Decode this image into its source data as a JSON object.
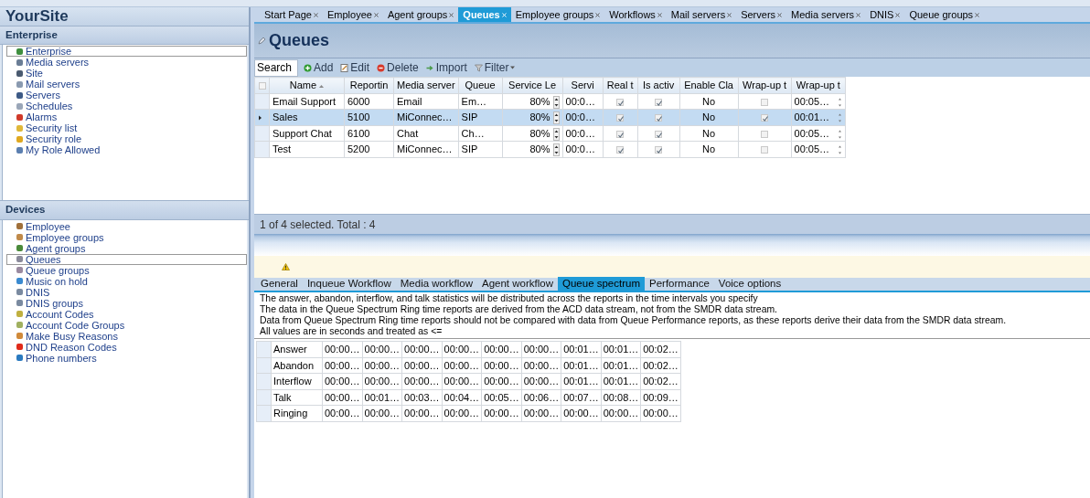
{
  "sidebar": {
    "title": "YourSite",
    "sections": [
      {
        "title": "Enterprise",
        "items": [
          {
            "label": "Enterprise",
            "selected": true,
            "color": "#3f8f3f"
          },
          {
            "label": "Media servers",
            "selected": false,
            "color": "#6a7d95"
          },
          {
            "label": "Site",
            "selected": false,
            "color": "#4a5a70"
          },
          {
            "label": "Mail servers",
            "selected": false,
            "color": "#8a9ab0"
          },
          {
            "label": "Servers",
            "selected": false,
            "color": "#3d5a86"
          },
          {
            "label": "Schedules",
            "selected": false,
            "color": "#9aa6b8"
          },
          {
            "label": "Alarms",
            "selected": false,
            "color": "#d03a2a"
          },
          {
            "label": "Security list",
            "selected": false,
            "color": "#e0b83a"
          },
          {
            "label": "Security role",
            "selected": false,
            "color": "#e0a820"
          },
          {
            "label": "My Role Allowed",
            "selected": false,
            "color": "#5b7fb0"
          }
        ]
      },
      {
        "title": "Devices",
        "items": [
          {
            "label": "Employee",
            "selected": false,
            "color": "#a0703a"
          },
          {
            "label": "Employee groups",
            "selected": false,
            "color": "#c08a4a"
          },
          {
            "label": "Agent groups",
            "selected": false,
            "color": "#4a8a3a"
          },
          {
            "label": "Queues",
            "selected": true,
            "color": "#8a8a9a"
          },
          {
            "label": "Queue groups",
            "selected": false,
            "color": "#9a8aa0"
          },
          {
            "label": "Music on hold",
            "selected": false,
            "color": "#3a8ad0"
          },
          {
            "label": "DNIS",
            "selected": false,
            "color": "#7a8aa0"
          },
          {
            "label": "DNIS groups",
            "selected": false,
            "color": "#7a8aa0"
          },
          {
            "label": "Account Codes",
            "selected": false,
            "color": "#c0b040"
          },
          {
            "label": "Account Code Groups",
            "selected": false,
            "color": "#a0b060"
          },
          {
            "label": "Make Busy Reasons",
            "selected": false,
            "color": "#d08a3a"
          },
          {
            "label": "DND Reason Codes",
            "selected": false,
            "color": "#e02a1a"
          },
          {
            "label": "Phone numbers",
            "selected": false,
            "color": "#2a7ac0"
          }
        ]
      }
    ]
  },
  "tabs": [
    {
      "label": "Start Page",
      "selected": false
    },
    {
      "label": "Employee",
      "selected": false
    },
    {
      "label": "Agent groups",
      "selected": false
    },
    {
      "label": "Queues",
      "selected": true
    },
    {
      "label": "Employee groups",
      "selected": false
    },
    {
      "label": "Workflows",
      "selected": false
    },
    {
      "label": "Mail servers",
      "selected": false
    },
    {
      "label": "Servers",
      "selected": false
    },
    {
      "label": "Media servers",
      "selected": false
    },
    {
      "label": "DNIS",
      "selected": false
    },
    {
      "label": "Queue groups",
      "selected": false
    }
  ],
  "page_title": "Queues",
  "toolbar": {
    "search": {
      "value": "Search"
    },
    "buttons": [
      {
        "kind": "add",
        "label": "Add"
      },
      {
        "kind": "edit",
        "label": "Edit"
      },
      {
        "kind": "delete",
        "label": "Delete"
      },
      {
        "kind": "import",
        "label": "Import"
      },
      {
        "kind": "filter",
        "label": "Filter"
      }
    ]
  },
  "grid": {
    "columns": [
      {
        "label": "Name",
        "kind": "text"
      },
      {
        "label": "Reportin",
        "kind": "text"
      },
      {
        "label": "Media server",
        "kind": "text"
      },
      {
        "label": "Queue",
        "kind": "text"
      },
      {
        "label": "Service Le",
        "kind": "spin"
      },
      {
        "label": "Servi",
        "kind": "text"
      },
      {
        "label": "Real t",
        "kind": "checkbox"
      },
      {
        "label": "Is activ",
        "kind": "checkbox"
      },
      {
        "label": "Enable Cla",
        "kind": "center"
      },
      {
        "label": "Wrap-up t",
        "kind": "checkbox"
      },
      {
        "label": "Wrap-up t",
        "kind": "time"
      }
    ],
    "rows": [
      {
        "selected": false,
        "cells": [
          "Email Support",
          "6000",
          "Email",
          "Em…",
          "80%",
          "00:0…",
          {
            "checked": true
          },
          {
            "checked": true
          },
          "No",
          {
            "checked": false
          },
          "00:05…"
        ]
      },
      {
        "selected": true,
        "cells": [
          "Sales",
          "5100",
          "MiConnec…",
          "SIP",
          "80%",
          "00:0…",
          {
            "checked": true
          },
          {
            "checked": true
          },
          "No",
          {
            "checked": true
          },
          "00:01…"
        ]
      },
      {
        "selected": false,
        "cells": [
          "Support Chat",
          "6100",
          "Chat",
          "Ch…",
          "80%",
          "00:0…",
          {
            "checked": true
          },
          {
            "checked": true
          },
          "No",
          {
            "checked": false
          },
          "00:05…"
        ]
      },
      {
        "selected": false,
        "cells": [
          "Test",
          "5200",
          "MiConnec…",
          "SIP",
          "80%",
          "00:0…",
          {
            "checked": true
          },
          {
            "checked": true
          },
          "No",
          {
            "checked": false
          },
          "00:05…"
        ]
      }
    ]
  },
  "status": "1 of 4 selected. Total : 4",
  "detail_tabs": [
    {
      "label": "General",
      "selected": false
    },
    {
      "label": "Inqueue Workflow",
      "selected": false
    },
    {
      "label": "Media workflow",
      "selected": false
    },
    {
      "label": "Agent workflow",
      "selected": false
    },
    {
      "label": "Queue spectrum",
      "selected": true
    },
    {
      "label": "Performance",
      "selected": false
    },
    {
      "label": "Voice options",
      "selected": false
    }
  ],
  "info_lines": [
    "The answer, abandon, interflow, and talk statistics will be distributed across the reports in the time intervals you specify",
    "The data in the Queue Spectrum Ring time reports are derived from the ACD data stream, not from the SMDR data stream.",
    "Data from Queue Spectrum Ring time reports should not be compared with data from Queue Performance reports, as these reports derive their data from the SMDR data stream.",
    "All values are in seconds and treated as <="
  ],
  "spectrum": {
    "rows": [
      {
        "label": "Answer",
        "values": [
          "00:00…",
          "00:00…",
          "00:00…",
          "00:00…",
          "00:00…",
          "00:00…",
          "00:01…",
          "00:01…",
          "00:02…"
        ]
      },
      {
        "label": "Abandon",
        "values": [
          "00:00…",
          "00:00…",
          "00:00…",
          "00:00…",
          "00:00…",
          "00:00…",
          "00:01…",
          "00:01…",
          "00:02…"
        ]
      },
      {
        "label": "Interflow",
        "values": [
          "00:00…",
          "00:00…",
          "00:00…",
          "00:00…",
          "00:00…",
          "00:00…",
          "00:01…",
          "00:01…",
          "00:02…"
        ]
      },
      {
        "label": "Talk",
        "values": [
          "00:00…",
          "00:01…",
          "00:03…",
          "00:04…",
          "00:05…",
          "00:06…",
          "00:07…",
          "00:08…",
          "00:09…"
        ]
      },
      {
        "label": "Ringing",
        "values": [
          "00:00…",
          "00:00…",
          "00:00…",
          "00:00…",
          "00:00…",
          "00:00…",
          "00:00…",
          "00:00…",
          "00:00…"
        ]
      }
    ]
  }
}
